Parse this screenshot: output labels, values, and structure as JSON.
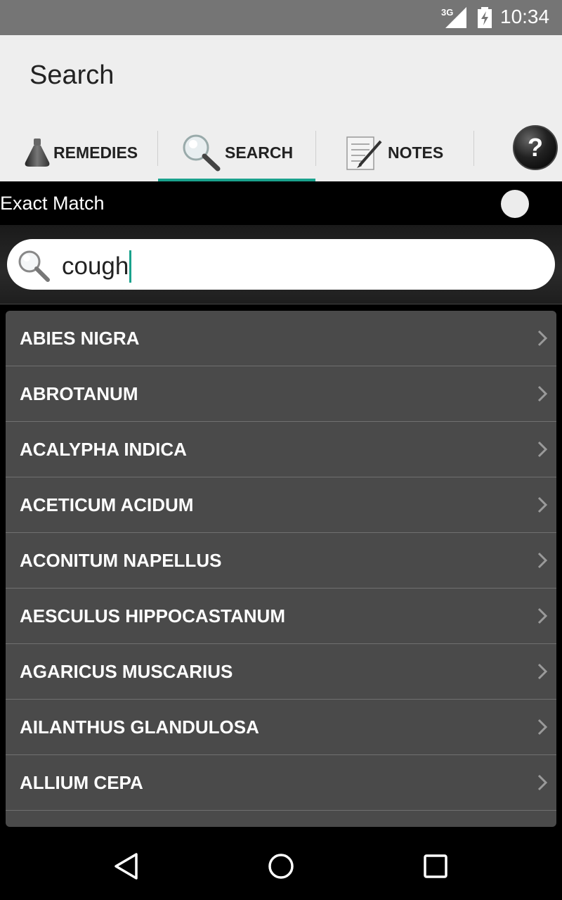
{
  "status_bar": {
    "network": "3G",
    "time": "10:34"
  },
  "app_bar": {
    "title": "Search"
  },
  "tabs": [
    {
      "label": "REMEDIES",
      "icon": "flask-icon"
    },
    {
      "label": "SEARCH",
      "icon": "magnifier-icon",
      "selected": true
    },
    {
      "label": "NOTES",
      "icon": "notepad-icon"
    }
  ],
  "help": {
    "glyph": "?",
    "icon": "help-icon"
  },
  "exact_match": {
    "label": "Exact Match",
    "enabled": false
  },
  "search": {
    "value": "cough",
    "icon": "search-icon"
  },
  "results": [
    "ABIES NIGRA",
    "ABROTANUM",
    "ACALYPHA INDICA",
    "ACETICUM ACIDUM",
    "ACONITUM NAPELLUS",
    "AESCULUS HIPPOCASTANUM",
    "AGARICUS MUSCARIUS",
    "AILANTHUS GLANDULOSA",
    "ALLIUM CEPA"
  ],
  "nav_bar": {
    "buttons": [
      "back-icon",
      "home-icon",
      "recents-icon"
    ]
  },
  "colors": {
    "accent": "#1aa28d",
    "list_bg": "#4a4a4a",
    "status_bar": "#757575",
    "app_bar": "#eeeeee"
  }
}
